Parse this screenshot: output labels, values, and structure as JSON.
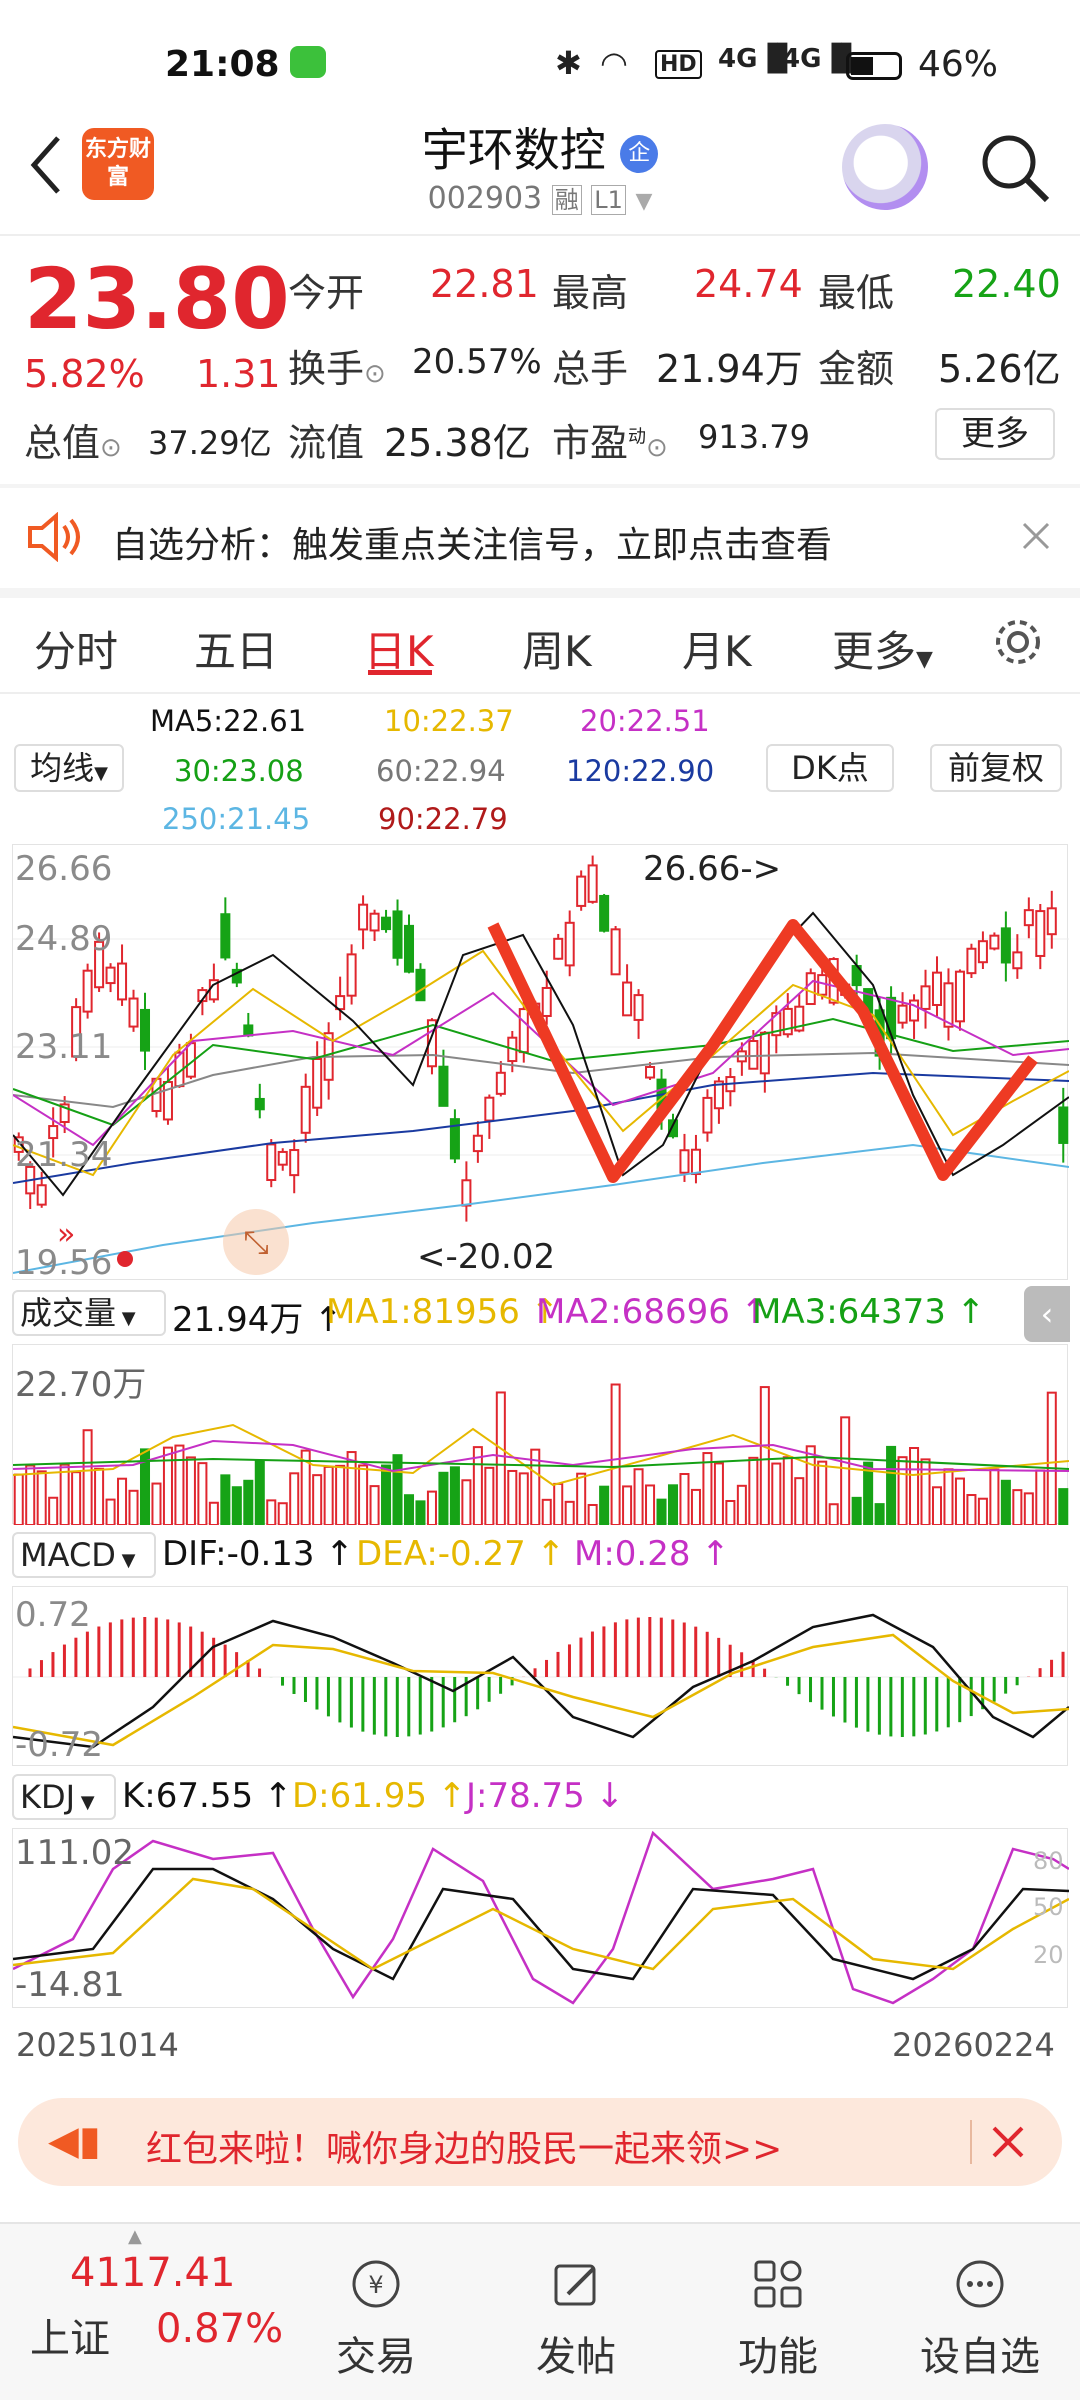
{
  "status_bar": {
    "time": "21:08",
    "battery": "46%",
    "network": "4G"
  },
  "header": {
    "logo_text": "东方财富",
    "title": "宇环数控",
    "badge": "企",
    "code": "002903",
    "tag_rong": "融",
    "tag_level": "L1"
  },
  "quote": {
    "price": "23.80",
    "change_pct": "5.82%",
    "change": "1.31",
    "open_label": "今开",
    "open": "22.81",
    "high_label": "最高",
    "high": "24.74",
    "low_label": "最低",
    "low": "22.40",
    "turnover_label": "换手",
    "turnover": "20.57%",
    "volume_label": "总手",
    "volume": "21.94万",
    "amount_label": "金额",
    "amount": "5.26亿",
    "mktcap_label": "总值",
    "mktcap": "37.29亿",
    "float_label": "流值",
    "float_cap": "25.38亿",
    "pe_label": "市盈",
    "pe_sup": "动",
    "pe": "913.79",
    "more": "更多"
  },
  "notice": {
    "text": "自选分析：触发重点关注信号，立即点击查看"
  },
  "tabs": {
    "items": [
      "分时",
      "五日",
      "日K",
      "周K",
      "月K",
      "更多"
    ],
    "active": "日K"
  },
  "ma": {
    "selector": "均线",
    "ma5": "MA5:22.61",
    "ma10": "10:22.37",
    "ma20": "20:22.51",
    "ma30": "30:23.08",
    "ma60": "60:22.94",
    "ma120": "120:22.90",
    "ma250": "250:21.45",
    "ma90": "90:22.79",
    "dk": "DK点",
    "adj": "前复权"
  },
  "kline": {
    "y_labels": [
      "26.66",
      "24.89",
      "23.11",
      "21.34",
      "19.56"
    ],
    "high_mark": "26.66->",
    "low_mark": "<-20.02"
  },
  "volume": {
    "selector": "成交量",
    "value": "21.94万",
    "ma1": "MA1:81956",
    "ma2": "MA2:68696",
    "ma3": "MA3:64373",
    "y_label": "22.70万"
  },
  "macd": {
    "selector": "MACD",
    "dif": "DIF:-0.13",
    "dea": "DEA:-0.27",
    "m": "M:0.28",
    "y_top": "0.72",
    "y_bottom": "-0.72"
  },
  "kdj": {
    "selector": "KDJ",
    "k": "K:67.55",
    "d": "D:61.95",
    "j": "J:78.75",
    "y_top": "111.02",
    "y_bottom": "-14.81",
    "lines": [
      "80",
      "50",
      "20"
    ]
  },
  "dates": {
    "start": "20251014",
    "end": "20260224"
  },
  "promo": {
    "text": "红包来啦！喊你身边的股民一起来领>>"
  },
  "bottom_bar": {
    "index_value": "4117.41",
    "index_name": "上证",
    "index_pct": "0.87%",
    "items": [
      "交易",
      "发帖",
      "功能",
      "设自选"
    ]
  },
  "chart_data": {
    "type": "candlestick",
    "x_range": [
      "20251014",
      "20260224"
    ],
    "ylim": [
      19.56,
      26.66
    ],
    "annotated_high": 26.66,
    "annotated_low": 20.02,
    "last_close": 23.8
  },
  "colors": {
    "up": "#e0262e",
    "down": "#16a316",
    "brand": "#f05a23"
  }
}
